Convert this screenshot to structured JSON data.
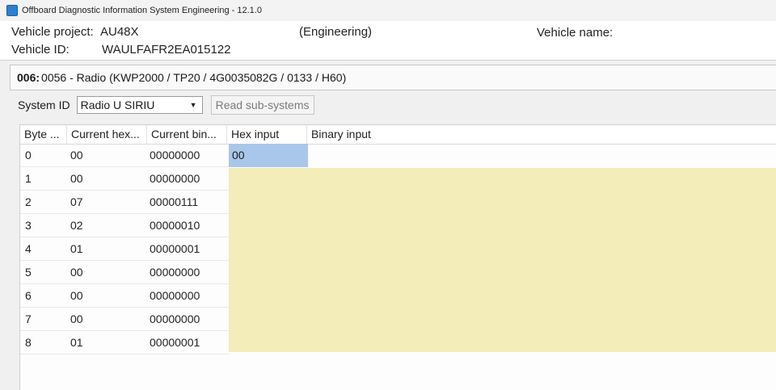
{
  "window": {
    "title": "Offboard Diagnostic Information System Engineering - 12.1.0"
  },
  "vehicle": {
    "project_label": "Vehicle project:",
    "project_value": "AU48X",
    "mode": "(Engineering)",
    "name_label": "Vehicle name:",
    "id_label": "Vehicle ID:",
    "id_value": "WAULFAFR2EA015122"
  },
  "ecu": {
    "number": "006:",
    "description": "0056 - Radio  (KWP2000 / TP20 / 4G0035082G / 0133 / H60)"
  },
  "system": {
    "label": "System ID",
    "selected": "Radio U SIRIU",
    "read_button": "Read sub-systems"
  },
  "table": {
    "columns": [
      "Byte ...",
      "Current hex...",
      "Current bin...",
      "Hex input",
      "Binary input"
    ],
    "rows": [
      {
        "byte": "0",
        "hex": "00",
        "bin": "00000000"
      },
      {
        "byte": "1",
        "hex": "00",
        "bin": "00000000"
      },
      {
        "byte": "2",
        "hex": "07",
        "bin": "00000111"
      },
      {
        "byte": "3",
        "hex": "02",
        "bin": "00000010"
      },
      {
        "byte": "4",
        "hex": "01",
        "bin": "00000001"
      },
      {
        "byte": "5",
        "hex": "00",
        "bin": "00000000"
      },
      {
        "byte": "6",
        "hex": "00",
        "bin": "00000000"
      },
      {
        "byte": "7",
        "hex": "00",
        "bin": "00000000"
      },
      {
        "byte": "8",
        "hex": "01",
        "bin": "00000001"
      }
    ],
    "hex_input_first": "00"
  },
  "colors": {
    "selection": "#a9c7ea",
    "input_area": "#f2edb9",
    "app_icon": "#2d7fd0"
  }
}
